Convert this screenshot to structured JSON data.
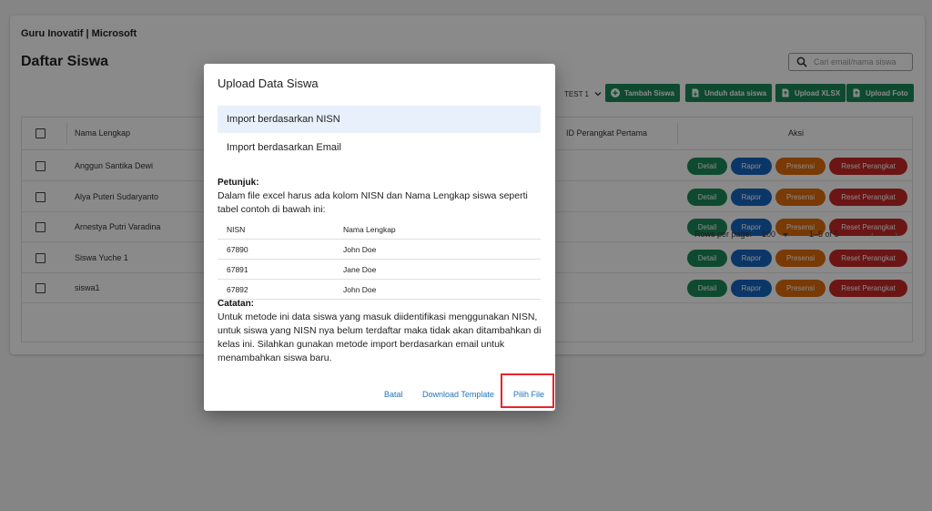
{
  "app": {
    "title": "Guru Inovatif | Microsoft"
  },
  "page": {
    "title": "Daftar Siswa"
  },
  "search": {
    "placeholder": "Cari email/nama siswa"
  },
  "class_select": {
    "value": "TEST 1"
  },
  "toolbar": {
    "add_label": "Tambah Siswa",
    "download_label": "Unduh data siswa",
    "upload_xlsx_label": "Upload XLSX",
    "upload_photo_label": "Upload Foto"
  },
  "table": {
    "headers": {
      "name": "Nama Lengkap",
      "device": "ID Perangkat Pertama",
      "actions": "Aksi"
    },
    "rows": [
      {
        "name": "Anggun Santika Dewi"
      },
      {
        "name": "Alya Puteri Sudaryanto"
      },
      {
        "name": "Arnestya Putri Varadina"
      },
      {
        "name": "Siswa Yuche 1"
      },
      {
        "name": "siswa1"
      }
    ],
    "row_actions": {
      "detail": "Detail",
      "rapor": "Rapor",
      "presensi": "Presensi",
      "reset": "Reset Perangkat"
    },
    "footer": {
      "rows_per_page_label": "Rows per page:",
      "rows_per_page_value": "100",
      "range": "1–5 of 5"
    }
  },
  "dialog": {
    "title": "Upload Data Siswa",
    "options": [
      "Import berdasarkan NISN",
      "Import berdasarkan Email"
    ],
    "petunjuk_head": "Petunjuk:",
    "petunjuk_text": "Dalam file excel harus ada kolom NISN dan Nama Lengkap siswa seperti tabel contoh di bawah ini:",
    "example_table": {
      "headers": [
        "NISN",
        "Nama Lengkap"
      ],
      "rows": [
        [
          "67890",
          "John Doe"
        ],
        [
          "67891",
          "Jane Doe"
        ],
        [
          "67892",
          "John Doe"
        ]
      ]
    },
    "catatan_head": "Catatan:",
    "catatan_text": "Untuk metode ini data siswa yang masuk diidentifikasi menggunakan NISN, untuk siswa yang NISN nya belum terdaftar maka tidak akan ditambahkan di kelas ini. Silahkan gunakan metode import berdasarkan email untuk menambahkan siswa baru.",
    "buttons": {
      "cancel": "Batal",
      "download_template": "Download Template",
      "pick_file": "Pilih File"
    }
  },
  "colors": {
    "green": "#1b8a5a",
    "blue": "#1565c0",
    "orange": "#e06b0a",
    "red": "#c62828",
    "link": "#1e73be",
    "highlight": "#e5252b"
  }
}
